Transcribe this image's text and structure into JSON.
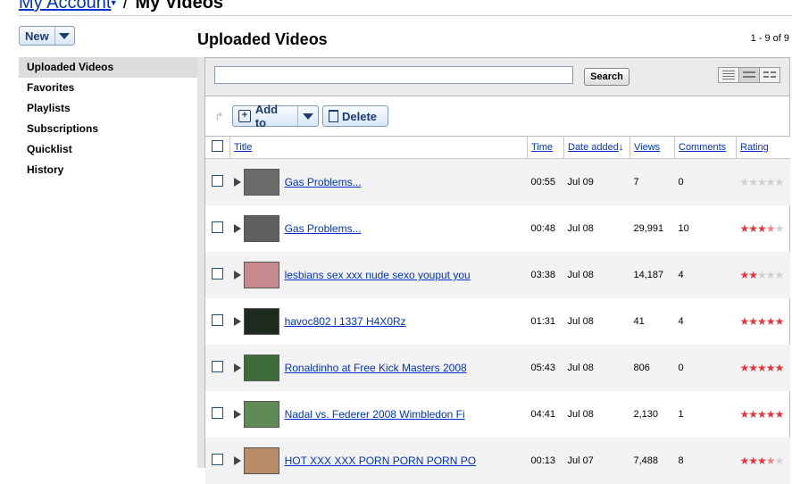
{
  "breadcrumb": {
    "account": "My Account",
    "current": "My Videos"
  },
  "new_button": {
    "label": "New"
  },
  "header": {
    "title": "Uploaded Videos",
    "count": "1 - 9 of 9"
  },
  "sidebar": {
    "items": [
      {
        "label": "Uploaded Videos",
        "selected": true
      },
      {
        "label": "Favorites"
      },
      {
        "label": "Playlists"
      },
      {
        "label": "Subscriptions"
      },
      {
        "label": "Quicklist"
      },
      {
        "label": "History"
      }
    ]
  },
  "search": {
    "value": "",
    "placeholder": "",
    "button_label": "Search"
  },
  "toolbar": {
    "add_to_label": "Add to",
    "delete_label": "Delete"
  },
  "columns": {
    "title": "Title",
    "time": "Time",
    "date_added": "Date added",
    "views": "Views",
    "comments": "Comments",
    "rating": "Rating"
  },
  "rows": [
    {
      "title": "Gas Problems...",
      "time": "00:55",
      "date": "Jul 09",
      "views": "7",
      "comments": "0",
      "rating": 0,
      "thumb_color": "#6a6a6a"
    },
    {
      "title": "Gas Problems...",
      "time": "00:48",
      "date": "Jul 08",
      "views": "29,991",
      "comments": "10",
      "rating": 3.5,
      "thumb_color": "#5e5e5e"
    },
    {
      "title": "lesbians sex xxx nude sexo youput you",
      "time": "03:38",
      "date": "Jul 08",
      "views": "14,187",
      "comments": "4",
      "rating": 2,
      "thumb_color": "#c98a8f"
    },
    {
      "title": "havoc802 l 1337 H4X0Rz",
      "time": "01:31",
      "date": "Jul 08",
      "views": "41",
      "comments": "4",
      "rating": 5,
      "thumb_color": "#1e2a1e"
    },
    {
      "title": "Ronaldinho at Free Kick Masters 2008",
      "time": "05:43",
      "date": "Jul 08",
      "views": "806",
      "comments": "0",
      "rating": 5,
      "thumb_color": "#3d6b3a"
    },
    {
      "title": "Nadal vs. Federer 2008 Wimbledon Fi",
      "time": "04:41",
      "date": "Jul 08",
      "views": "2,130",
      "comments": "1",
      "rating": 5,
      "thumb_color": "#5f8a55"
    },
    {
      "title": "HOT XXX XXX PORN PORN PORN PO",
      "time": "00:13",
      "date": "Jul 07",
      "views": "7,488",
      "comments": "8",
      "rating": 3.5,
      "thumb_color": "#b98c6a"
    }
  ]
}
